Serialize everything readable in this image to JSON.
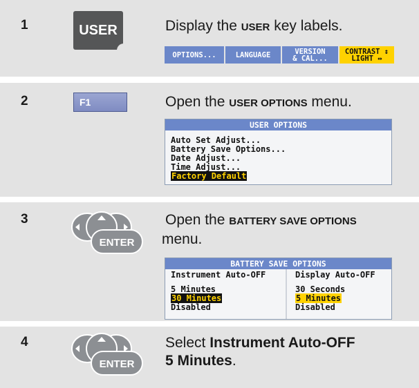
{
  "steps": [
    {
      "number": "1",
      "key_label": "USER",
      "text_before": "Display the ",
      "text_key": "USER",
      "text_after": " key labels.",
      "softkeys": [
        "OPTIONS...",
        "LANGUAGE",
        "VERSION",
        "& CAL...",
        "CONTRAST ↕",
        "LIGHT ↔"
      ]
    },
    {
      "number": "2",
      "key_label": "F1",
      "text_before": "Open the ",
      "text_key": "USER OPTIONS",
      "text_after": " menu.",
      "menu_title": "USER OPTIONS",
      "menu_items": [
        "Auto Set Adjust...",
        "Battery Save Options...",
        "Date Adjust...",
        "Time Adjust...",
        "Factory Default"
      ]
    },
    {
      "number": "3",
      "key_label": "ENTER",
      "text_before": "Open the ",
      "text_key": "BATTERY SAVE OPTIONS",
      "text_after": " menu.",
      "panel_title": "BATTERY SAVE OPTIONS",
      "left_col_title": "Instrument Auto-OFF",
      "left_options": [
        "5 Minutes",
        "30 Minutes",
        "Disabled"
      ],
      "right_col_title": "Display Auto-OFF",
      "right_options": [
        "30 Seconds",
        "5 Minutes",
        "Disabled"
      ]
    },
    {
      "number": "4",
      "key_label": "ENTER",
      "text_before": "Select ",
      "text_bold1": "Instrument Auto-OFF",
      "text_bold2": "5 Minutes",
      "text_after": "."
    }
  ],
  "colors": {
    "band": "#e3e3e3",
    "softkey": "#6b87c9",
    "highlight": "#ffd200",
    "key_dark": "#555657",
    "enter_key": "#8c8f93"
  },
  "icons": [
    "navigation-pad-icon",
    "enter-key-icon"
  ]
}
